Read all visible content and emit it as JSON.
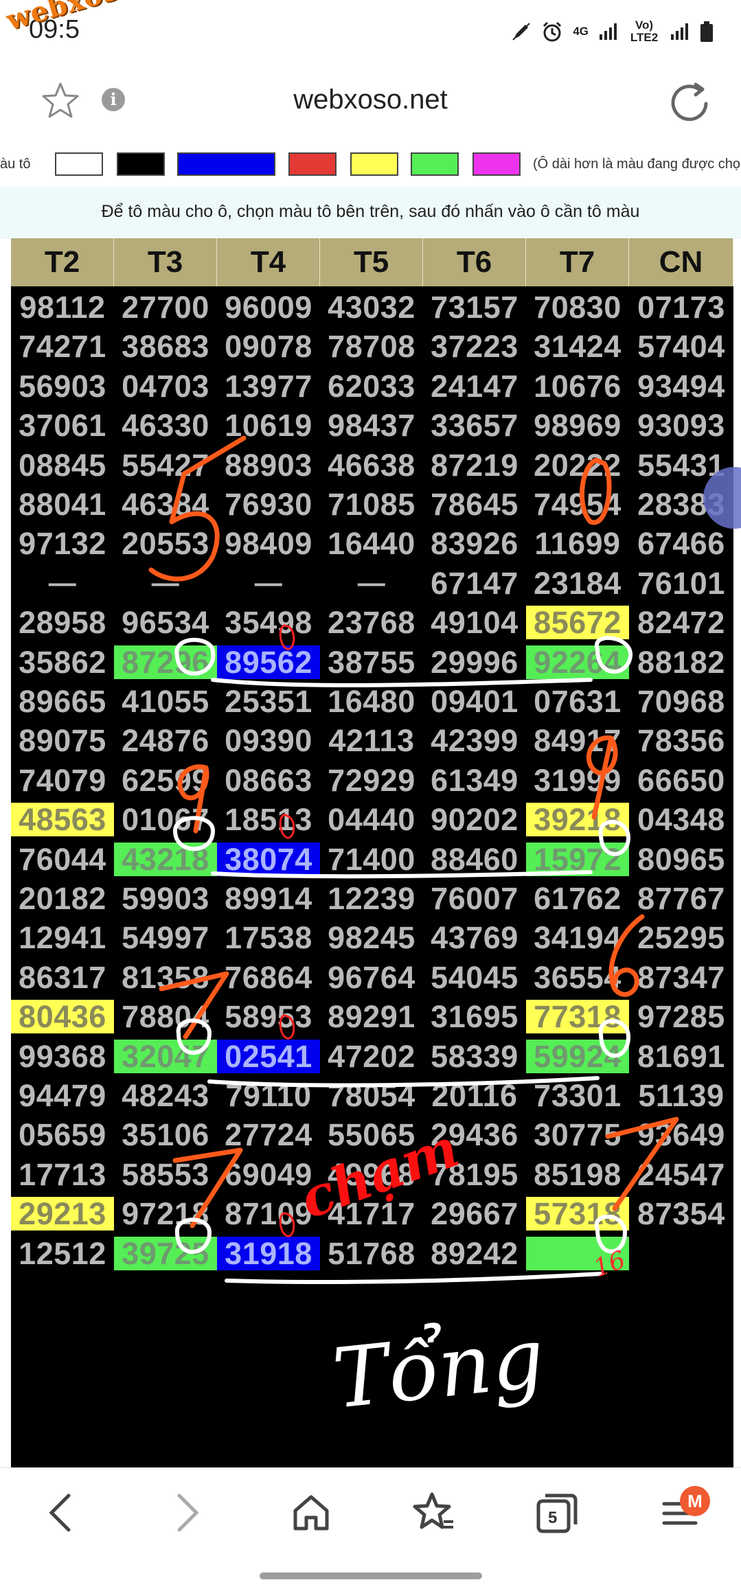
{
  "status_bar": {
    "time": "09:5",
    "watermark": "webxoso.net",
    "net1": "4G",
    "net2": "Vo) LTE2"
  },
  "browser": {
    "url": "webxoso.net"
  },
  "palette": {
    "label": "àu tô",
    "note": "(Ô dài hơn là màu đang được chọn",
    "swatches": [
      "#ffffff",
      "#000000",
      "#0000ee",
      "#e53935",
      "#ffff55",
      "#55ee55",
      "#ee33ee"
    ]
  },
  "instruction": "Để tô màu cho ô, chọn màu tô bên trên, sau đó nhấn vào ô cần tô màu",
  "table": {
    "headers": [
      "T2",
      "T3",
      "T4",
      "T5",
      "T6",
      "T7",
      "CN"
    ],
    "rows": [
      [
        "98112",
        "27700",
        "96009",
        "43032",
        "73157",
        "70830",
        "07173"
      ],
      [
        "74271",
        "38683",
        "09078",
        "78708",
        "37223",
        "31424",
        "57404"
      ],
      [
        "56903",
        "04703",
        "13977",
        "62033",
        "24147",
        "10676",
        "93494"
      ],
      [
        "37061",
        "46330",
        "10619",
        "98437",
        "33657",
        "98969",
        "93093"
      ],
      [
        "08845",
        "55427",
        "88903",
        "46638",
        "87219",
        "20222",
        "55431"
      ],
      [
        "88041",
        "46384",
        "76930",
        "71085",
        "78645",
        "74954",
        "28383"
      ],
      [
        "97132",
        "20553",
        "98409",
        "16440",
        "83926",
        "11699",
        "67466"
      ],
      [
        "—",
        "—",
        "—",
        "—",
        "67147",
        "23184",
        "76101"
      ],
      [
        "28958",
        "96534",
        "35498",
        "23768",
        "49104",
        "85672",
        "82472"
      ],
      [
        "35862",
        "87296",
        "89562",
        "38755",
        "29996",
        "92264",
        "88182"
      ],
      [
        "89665",
        "41055",
        "25351",
        "16480",
        "09401",
        "07631",
        "70968"
      ],
      [
        "89075",
        "24876",
        "09390",
        "42113",
        "42399",
        "84917",
        "78356"
      ],
      [
        "74079",
        "62599",
        "08663",
        "72929",
        "61349",
        "31999",
        "66650"
      ],
      [
        "48563",
        "01067",
        "18513",
        "04440",
        "90202",
        "39218",
        "04348"
      ],
      [
        "76044",
        "43218",
        "38074",
        "71400",
        "88460",
        "15972",
        "80965"
      ],
      [
        "20182",
        "59903",
        "89914",
        "12239",
        "76007",
        "61762",
        "87767"
      ],
      [
        "12941",
        "54997",
        "17538",
        "98245",
        "43769",
        "34194",
        "25295"
      ],
      [
        "86317",
        "81358",
        "76864",
        "96764",
        "54045",
        "36554",
        "87347"
      ],
      [
        "80436",
        "78804",
        "58953",
        "89291",
        "31695",
        "77318",
        "97285"
      ],
      [
        "99368",
        "32047",
        "02541",
        "47202",
        "58339",
        "59924",
        "81691"
      ],
      [
        "94479",
        "48243",
        "79110",
        "78054",
        "20116",
        "73301",
        "51139"
      ],
      [
        "05659",
        "35106",
        "27724",
        "55065",
        "29436",
        "30775",
        "93649"
      ],
      [
        "17713",
        "58553",
        "69049",
        "49968",
        "78195",
        "85198",
        "24547"
      ],
      [
        "29213",
        "97218",
        "87109",
        "41717",
        "29667",
        "57318",
        "87354"
      ],
      [
        "12512",
        "39725",
        "31918",
        "51768",
        "89242",
        "",
        ""
      ]
    ]
  },
  "highlights": [
    {
      "row": 8,
      "col": 5,
      "color": "yellow"
    },
    {
      "row": 9,
      "col": 1,
      "color": "green"
    },
    {
      "row": 9,
      "col": 2,
      "color": "blue"
    },
    {
      "row": 9,
      "col": 5,
      "color": "green"
    },
    {
      "row": 13,
      "col": 0,
      "color": "yellow"
    },
    {
      "row": 13,
      "col": 5,
      "color": "yellow"
    },
    {
      "row": 14,
      "col": 1,
      "color": "green"
    },
    {
      "row": 14,
      "col": 2,
      "color": "blue"
    },
    {
      "row": 14,
      "col": 5,
      "color": "green"
    },
    {
      "row": 18,
      "col": 0,
      "color": "yellow"
    },
    {
      "row": 18,
      "col": 5,
      "color": "yellow"
    },
    {
      "row": 19,
      "col": 1,
      "color": "green"
    },
    {
      "row": 19,
      "col": 2,
      "color": "blue"
    },
    {
      "row": 19,
      "col": 5,
      "color": "green"
    },
    {
      "row": 23,
      "col": 0,
      "color": "yellow"
    },
    {
      "row": 23,
      "col": 5,
      "color": "yellow"
    },
    {
      "row": 24,
      "col": 1,
      "color": "green"
    },
    {
      "row": 24,
      "col": 2,
      "color": "blue"
    },
    {
      "row": 24,
      "col": 5,
      "color": "green"
    }
  ],
  "annotations": {
    "orange_digits": [
      "5",
      "0",
      "9",
      "9",
      "7",
      "6",
      "7",
      "7"
    ],
    "red_text": "chạm",
    "red_small": "16",
    "white_text": "Tổng"
  },
  "bottom_nav": {
    "tab_count": "5",
    "badge": "M"
  }
}
